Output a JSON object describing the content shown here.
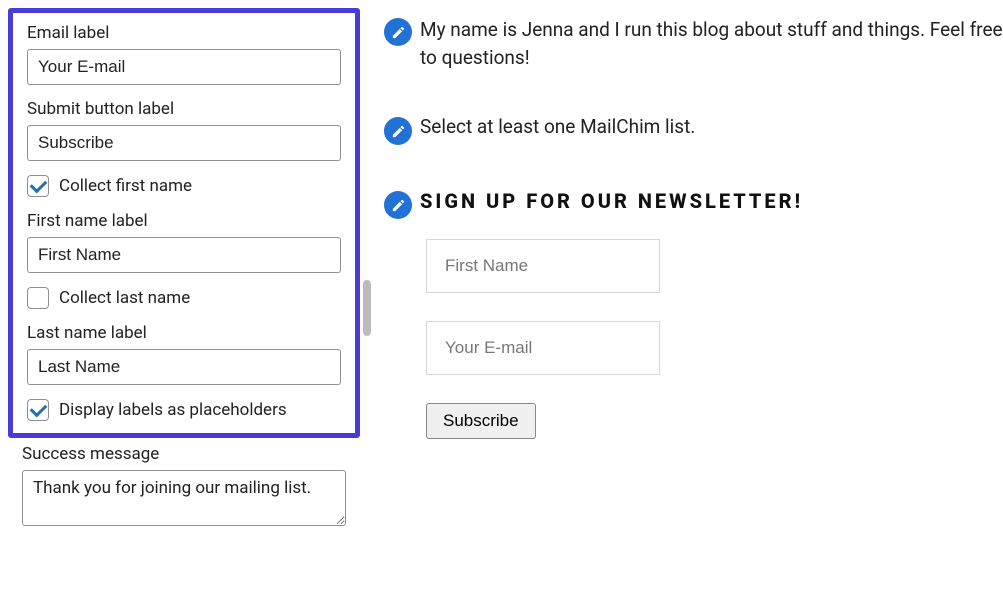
{
  "sidebar": {
    "email_label_title": "Email label",
    "email_label_value": "Your E-mail",
    "submit_label_title": "Submit button label",
    "submit_label_value": "Subscribe",
    "collect_first_name_label": "Collect first name",
    "first_name_label_title": "First name label",
    "first_name_label_value": "First Name",
    "collect_last_name_label": "Collect last name",
    "last_name_label_title": "Last name label",
    "last_name_label_value": "Last Name",
    "display_placeholders_label": "Display labels as placeholders",
    "success_message_title": "Success message",
    "success_message_value": "Thank you for joining our mailing list."
  },
  "preview": {
    "intro_text": "My name is Jenna and I run this blog about stuff and things. Feel free to questions!",
    "warning_text": "Select at least one MailChim list.",
    "newsletter_heading": "SIGN UP FOR OUR NEWSLETTER!",
    "first_name_placeholder": "First Name",
    "email_placeholder": "Your E-mail",
    "subscribe_label": "Subscribe"
  }
}
